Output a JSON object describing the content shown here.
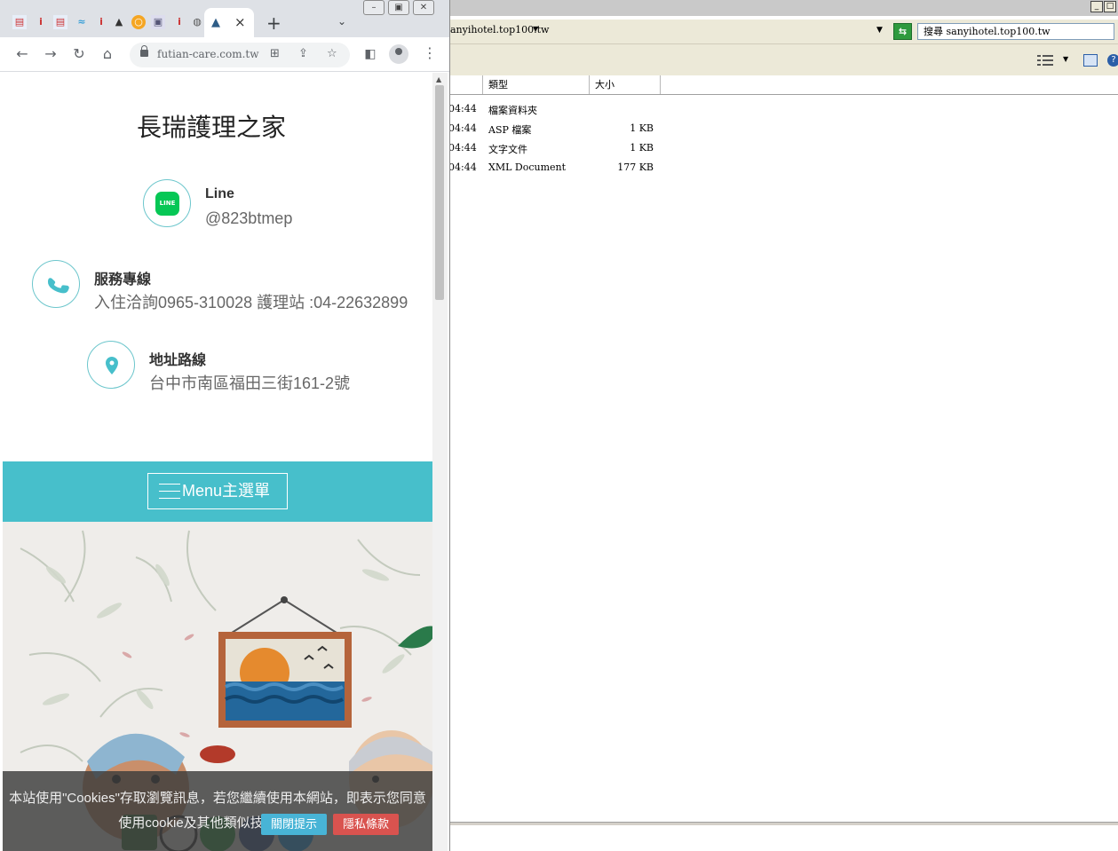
{
  "explorer": {
    "address": "anyihotel.top100.tw",
    "search_box": "搜尋 sanyihotel.top100.tw",
    "columns": {
      "type": "類型",
      "size": "大小"
    },
    "rows": [
      {
        "time": "04:44",
        "type": "檔案資料夾",
        "size": ""
      },
      {
        "time": "04:44",
        "type": "ASP 檔案",
        "size": "1 KB"
      },
      {
        "time": "04:44",
        "type": "文字文件",
        "size": "1 KB"
      },
      {
        "time": "04:44",
        "type": "XML Document",
        "size": "177 KB"
      }
    ]
  },
  "browser": {
    "url": "futian-care.com.tw",
    "new_tab_symbol": "+",
    "tab_close_symbol": "×"
  },
  "page": {
    "title": "長瑞護理之家",
    "contacts": {
      "line": {
        "label": "Line",
        "value": "@823btmep",
        "logo_text": "LINE"
      },
      "phone": {
        "label": "服務專線",
        "value": "入住洽詢0965-310028 護理站 :04-22632899"
      },
      "address": {
        "label": "地址路線",
        "value": "台中市南區福田三街161-2號"
      }
    },
    "menu_label": "Menu主選單",
    "cookie": {
      "text": "本站使用\"Cookies\"存取瀏覽訊息，若您繼續使用本網站，即表示您同意使用cookie及其他類似技術應用。",
      "close_label": "關閉提示",
      "privacy_label": "隱私條款"
    }
  },
  "colors": {
    "accent": "#47bfcb",
    "line_green": "#06c755",
    "privacy_red": "#d9534f",
    "close_blue": "#48b4d6"
  }
}
